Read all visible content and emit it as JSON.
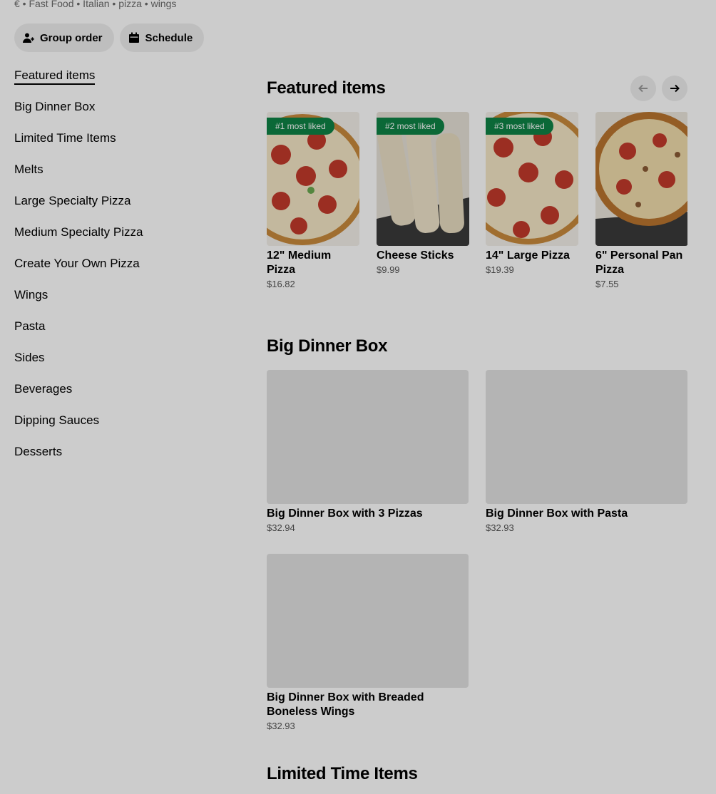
{
  "store": {
    "cuisine_line": "€ • Fast Food • Italian • pizza • wings"
  },
  "actions": {
    "group_order": "Group order",
    "schedule": "Schedule"
  },
  "sidebar": {
    "items": [
      {
        "label": "Featured items"
      },
      {
        "label": "Big Dinner Box"
      },
      {
        "label": "Limited Time Items"
      },
      {
        "label": "Melts"
      },
      {
        "label": "Large Specialty Pizza"
      },
      {
        "label": "Medium Specialty Pizza"
      },
      {
        "label": "Create Your Own Pizza"
      },
      {
        "label": "Wings"
      },
      {
        "label": "Pasta"
      },
      {
        "label": "Sides"
      },
      {
        "label": "Beverages"
      },
      {
        "label": "Dipping Sauces"
      },
      {
        "label": "Desserts"
      }
    ]
  },
  "featured": {
    "title": "Featured items",
    "items": [
      {
        "badge": "#1 most liked",
        "name": "12\" Medium Pizza",
        "price": "$16.82",
        "icon": "pepperoni-pizza-image"
      },
      {
        "badge": "#2 most liked",
        "name": "Cheese Sticks",
        "price": "$9.99",
        "icon": "breadsticks-image"
      },
      {
        "badge": "#3 most liked",
        "name": "14\" Large Pizza",
        "price": "$19.39",
        "icon": "pepperoni-pizza-image"
      },
      {
        "badge": "",
        "name": "6\" Personal Pan Pizza",
        "price": "$7.55",
        "icon": "pan-pizza-image"
      }
    ]
  },
  "big_dinner_box": {
    "title": "Big Dinner Box",
    "items": [
      {
        "name": "Big Dinner Box with 3 Pizzas",
        "price": "$32.94"
      },
      {
        "name": "Big Dinner Box with Pasta",
        "price": "$32.93"
      },
      {
        "name": "Big Dinner Box with Breaded Boneless Wings",
        "price": "$32.93"
      }
    ]
  },
  "limited_time": {
    "title": "Limited Time Items"
  },
  "colors": {
    "badge": "#0e8345",
    "overlay": "rgba(0,0,0,0.2)",
    "pill_bg": "#eeeeee"
  },
  "icons": {
    "group_order": "person-add-icon",
    "schedule": "calendar-icon",
    "prev": "arrow-left-icon",
    "next": "arrow-right-icon"
  }
}
